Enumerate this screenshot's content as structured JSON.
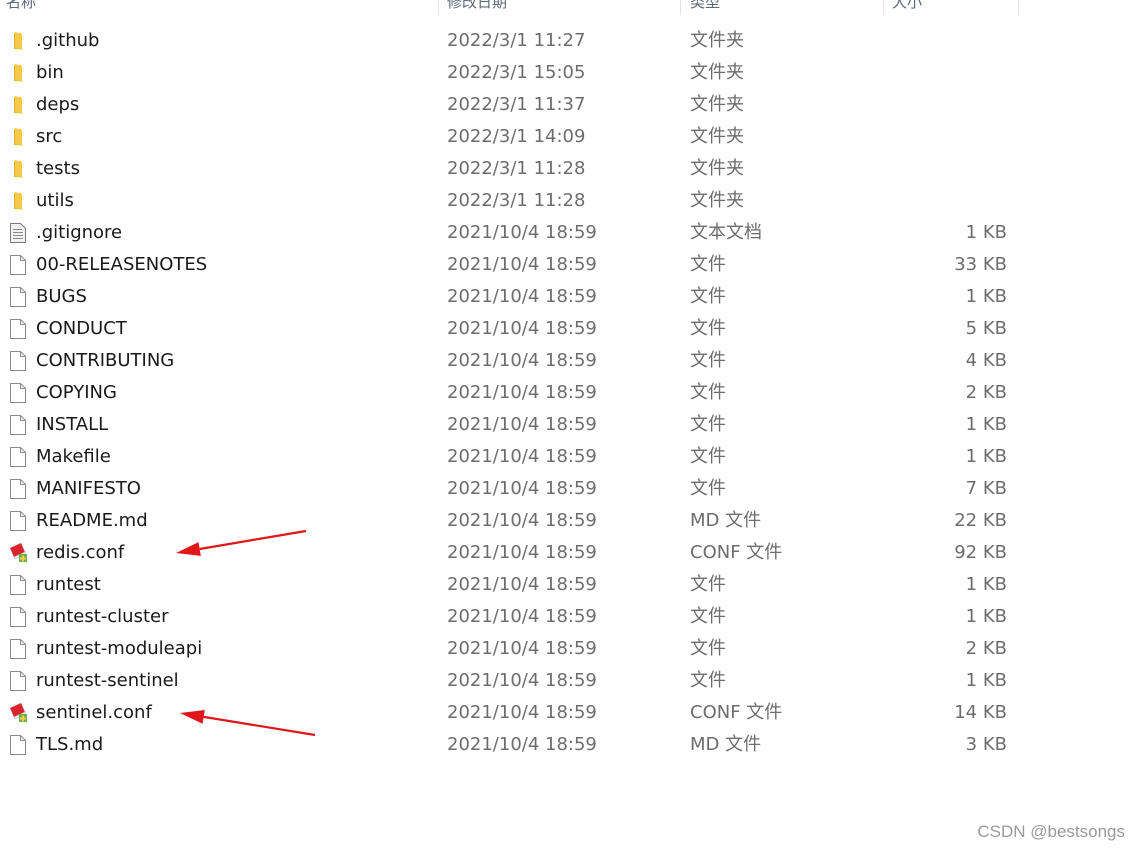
{
  "header": {
    "col_name": "名称",
    "col_date": "修改日期",
    "col_type": "类型",
    "col_size": "大小"
  },
  "rows": [
    {
      "name": ".github",
      "date": "2022/3/1 11:27",
      "type": "文件夹",
      "size": "",
      "icon": "folder"
    },
    {
      "name": "bin",
      "date": "2022/3/1 15:05",
      "type": "文件夹",
      "size": "",
      "icon": "folder"
    },
    {
      "name": "deps",
      "date": "2022/3/1 11:37",
      "type": "文件夹",
      "size": "",
      "icon": "folder"
    },
    {
      "name": "src",
      "date": "2022/3/1 14:09",
      "type": "文件夹",
      "size": "",
      "icon": "folder"
    },
    {
      "name": "tests",
      "date": "2022/3/1 11:28",
      "type": "文件夹",
      "size": "",
      "icon": "folder"
    },
    {
      "name": "utils",
      "date": "2022/3/1 11:28",
      "type": "文件夹",
      "size": "",
      "icon": "folder"
    },
    {
      "name": ".gitignore",
      "date": "2021/10/4 18:59",
      "type": "文本文档",
      "size": "1 KB",
      "icon": "text-file"
    },
    {
      "name": "00-RELEASENOTES",
      "date": "2021/10/4 18:59",
      "type": "文件",
      "size": "33 KB",
      "icon": "file"
    },
    {
      "name": "BUGS",
      "date": "2021/10/4 18:59",
      "type": "文件",
      "size": "1 KB",
      "icon": "file"
    },
    {
      "name": "CONDUCT",
      "date": "2021/10/4 18:59",
      "type": "文件",
      "size": "5 KB",
      "icon": "file"
    },
    {
      "name": "CONTRIBUTING",
      "date": "2021/10/4 18:59",
      "type": "文件",
      "size": "4 KB",
      "icon": "file"
    },
    {
      "name": "COPYING",
      "date": "2021/10/4 18:59",
      "type": "文件",
      "size": "2 KB",
      "icon": "file"
    },
    {
      "name": "INSTALL",
      "date": "2021/10/4 18:59",
      "type": "文件",
      "size": "1 KB",
      "icon": "file"
    },
    {
      "name": "Makefile",
      "date": "2021/10/4 18:59",
      "type": "文件",
      "size": "1 KB",
      "icon": "file"
    },
    {
      "name": "MANIFESTO",
      "date": "2021/10/4 18:59",
      "type": "文件",
      "size": "7 KB",
      "icon": "file"
    },
    {
      "name": "README.md",
      "date": "2021/10/4 18:59",
      "type": "MD 文件",
      "size": "22 KB",
      "icon": "file"
    },
    {
      "name": "redis.conf",
      "date": "2021/10/4 18:59",
      "type": "CONF 文件",
      "size": "92 KB",
      "icon": "conf-file"
    },
    {
      "name": "runtest",
      "date": "2021/10/4 18:59",
      "type": "文件",
      "size": "1 KB",
      "icon": "file"
    },
    {
      "name": "runtest-cluster",
      "date": "2021/10/4 18:59",
      "type": "文件",
      "size": "1 KB",
      "icon": "file"
    },
    {
      "name": "runtest-moduleapi",
      "date": "2021/10/4 18:59",
      "type": "文件",
      "size": "2 KB",
      "icon": "file"
    },
    {
      "name": "runtest-sentinel",
      "date": "2021/10/4 18:59",
      "type": "文件",
      "size": "1 KB",
      "icon": "file"
    },
    {
      "name": "sentinel.conf",
      "date": "2021/10/4 18:59",
      "type": "CONF 文件",
      "size": "14 KB",
      "icon": "conf-file"
    },
    {
      "name": "TLS.md",
      "date": "2021/10/4 18:59",
      "type": "MD 文件",
      "size": "3 KB",
      "icon": "file"
    }
  ],
  "annotations": {
    "arrow_color": "#e0161b",
    "arrow_targets": [
      "redis.conf",
      "sentinel.conf"
    ]
  },
  "watermark": "CSDN @bestsongs"
}
